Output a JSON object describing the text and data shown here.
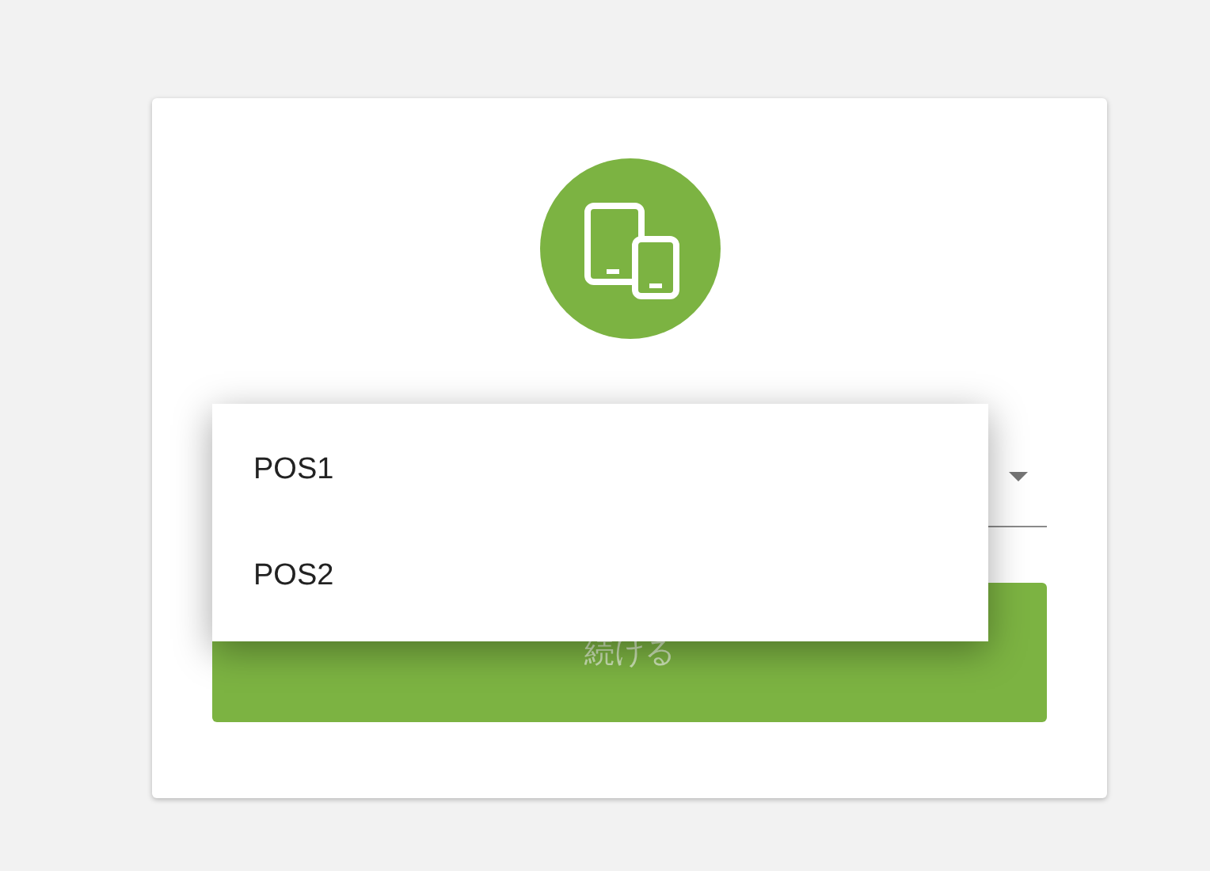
{
  "select": {
    "expanded": true,
    "options": [
      {
        "label": "POS1",
        "selected": false
      },
      {
        "label": "POS2",
        "selected": false
      }
    ]
  },
  "button": {
    "label": "続ける",
    "disabled": true
  }
}
